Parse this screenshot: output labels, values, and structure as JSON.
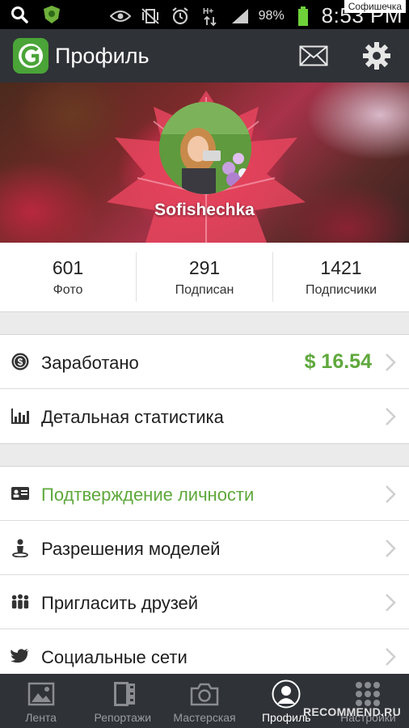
{
  "status_bar": {
    "battery_percent": "98%",
    "clock": "8:53 PM",
    "network_type": "H+",
    "watermark": "Софишечка",
    "icons": [
      "search-icon",
      "shield-app-icon",
      "eye-icon",
      "vibrate-mute-icon",
      "alarm-icon",
      "data-arrows-icon",
      "signal-icon",
      "battery-icon"
    ]
  },
  "action_bar": {
    "title": "Профиль",
    "icons": [
      "app-logo-icon",
      "mail-icon",
      "gear-icon"
    ]
  },
  "profile": {
    "username": "Sofishechka"
  },
  "stats": [
    {
      "value": "601",
      "label": "Фото"
    },
    {
      "value": "291",
      "label": "Подписан"
    },
    {
      "value": "1421",
      "label": "Подписчики"
    }
  ],
  "section1": [
    {
      "icon": "dollar-coin-icon",
      "label": "Заработано",
      "value": "$ 16.54"
    },
    {
      "icon": "bar-chart-icon",
      "label": "Детальная статистика"
    }
  ],
  "section2": [
    {
      "icon": "id-card-icon",
      "label": "Подтверждение личности"
    },
    {
      "icon": "model-pin-icon",
      "label": "Разрешения моделей"
    },
    {
      "icon": "people-icon",
      "label": "Пригласить друзей"
    },
    {
      "icon": "twitter-bird-icon",
      "label": "Социальные сети"
    }
  ],
  "bottom_nav": [
    {
      "icon": "image-icon",
      "label": "Лента"
    },
    {
      "icon": "film-icon",
      "label": "Репортажи"
    },
    {
      "icon": "camera-icon",
      "label": "Мастерская"
    },
    {
      "icon": "profile-icon",
      "label": "Профиль",
      "active": true
    },
    {
      "icon": "grid-dots-icon",
      "label": "Настройки"
    }
  ],
  "watermark_bottom": "RECOMMEND.RU",
  "colors": {
    "accent_green": "#5fa83c",
    "bar_background": "#2f3237"
  }
}
